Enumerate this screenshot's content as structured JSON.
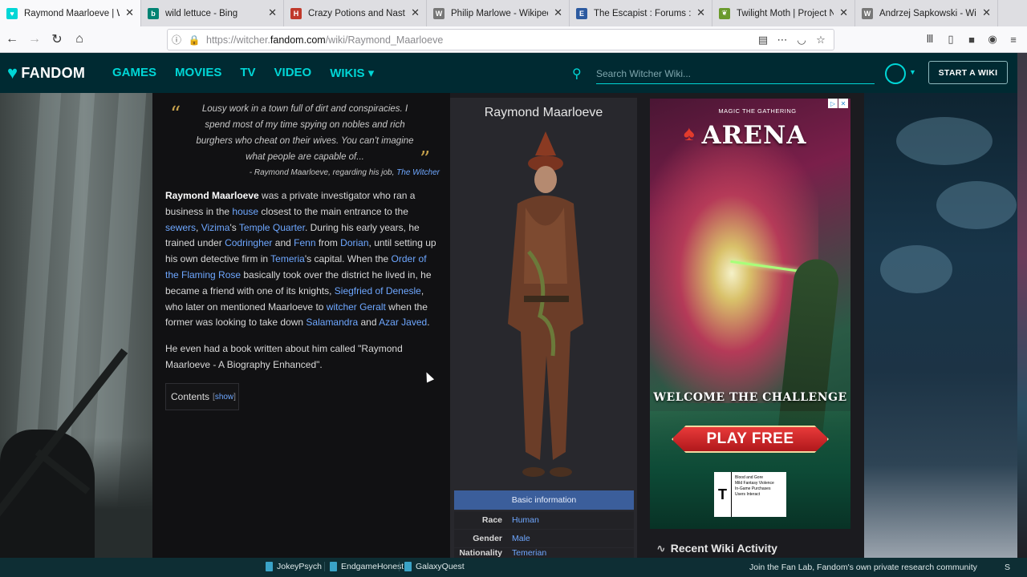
{
  "browser": {
    "tabs": [
      {
        "title": "Raymond Maarloeve | Witcher",
        "favicon": "fandom-icon",
        "color": "#00d6d6",
        "glyph": "♥"
      },
      {
        "title": "wild lettuce - Bing",
        "favicon": "bing-icon",
        "color": "#008373",
        "glyph": "b"
      },
      {
        "title": "Crazy Potions and Nasty Nostrums",
        "favicon": "site-icon",
        "color": "#c0392b",
        "glyph": "H"
      },
      {
        "title": "Philip Marlowe - Wikipedia",
        "favicon": "wikipedia-icon",
        "color": "#777777",
        "glyph": "W"
      },
      {
        "title": "The Escapist : Forums : Off-topic",
        "favicon": "escapist-icon",
        "color": "#2c5aa0",
        "glyph": "E"
      },
      {
        "title": "Twilight Moth | Project Noah",
        "favicon": "leaf-icon",
        "color": "#6a9a2c",
        "glyph": "❦"
      },
      {
        "title": "Andrzej Sapkowski - Wikipedia",
        "favicon": "wikipedia-icon",
        "color": "#777777",
        "glyph": "W"
      }
    ],
    "url_prefix": "https://witcher.",
    "url_domain": "fandom.com",
    "url_path": "/wiki/Raymond_Maarloeve"
  },
  "header": {
    "logo": "FANDOM",
    "nav": [
      "GAMES",
      "MOVIES",
      "TV",
      "VIDEO",
      "WIKIS ▾"
    ],
    "search_placeholder": "Search Witcher Wiki...",
    "start_wiki": "START A WIKI"
  },
  "article": {
    "quote": "Lousy work in a town full of dirt and conspiracies. I spend most of my time spying on nobles and rich burghers who cheat on their wives. You can't imagine what people are capable of...",
    "quote_attr_prefix": "- Raymond Maarloeve, regarding his job, ",
    "quote_attr_link": "The Witcher",
    "p1": [
      {
        "t": "Raymond Maarloeve",
        "s": "b"
      },
      {
        "t": " was a private investigator who ran a business in the "
      },
      {
        "t": "house",
        "s": "a"
      },
      {
        "t": " closest to the main entrance to the "
      },
      {
        "t": "sewers",
        "s": "a"
      },
      {
        "t": ", "
      },
      {
        "t": "Vizima",
        "s": "a"
      },
      {
        "t": "'s "
      },
      {
        "t": "Temple Quarter",
        "s": "a"
      },
      {
        "t": ". During his early years, he trained under "
      },
      {
        "t": "Codringher",
        "s": "a"
      },
      {
        "t": " and "
      },
      {
        "t": "Fenn",
        "s": "a"
      },
      {
        "t": " from "
      },
      {
        "t": "Dorian",
        "s": "a"
      },
      {
        "t": ", until setting up his own detective firm in "
      },
      {
        "t": "Temeria",
        "s": "a"
      },
      {
        "t": "'s capital. When the "
      },
      {
        "t": "Order of the Flaming Rose",
        "s": "a"
      },
      {
        "t": " basically took over the district he lived in, he became a friend with one of its knights, "
      },
      {
        "t": "Siegfried of Denesle",
        "s": "a"
      },
      {
        "t": ", who later on mentioned Maarloeve to "
      },
      {
        "t": "witcher",
        "s": "a"
      },
      {
        "t": " "
      },
      {
        "t": "Geralt",
        "s": "a"
      },
      {
        "t": " when the former was looking to take down "
      },
      {
        "t": "Salamandra",
        "s": "a"
      },
      {
        "t": " and "
      },
      {
        "t": "Azar Javed",
        "s": "a"
      },
      {
        "t": "."
      }
    ],
    "p2": "He even had a book written about him called \"Raymond Maarloeve - A Biography Enhanced\".",
    "contents_label": "Contents",
    "contents_show": "show"
  },
  "infobox": {
    "title": "Raymond Maarloeve",
    "section": "Basic information",
    "rows": [
      {
        "key": "Race",
        "value": "Human"
      },
      {
        "key": "Gender",
        "value": "Male"
      },
      {
        "key": "Nationality",
        "value": "Temerian"
      }
    ]
  },
  "ad": {
    "brand_small": "MAGIC THE GATHERING",
    "brand": "ARENA",
    "tagline": "WELCOME THE CHALLENGE",
    "cta": "PLAY FREE",
    "rating_letter": "T",
    "rating_desc": "Blood and Gore\nMild Fantasy Violence\nIn-Game Purchases\nUsers Interact"
  },
  "recent_activity": "Recent Wiki Activity",
  "bottom_bar": {
    "tools": [
      "JokeyPsych",
      "EndgameHonest",
      "GalaxyQuest"
    ],
    "fanlab": "Join the Fan Lab, Fandom's own private research community",
    "end": "S"
  }
}
